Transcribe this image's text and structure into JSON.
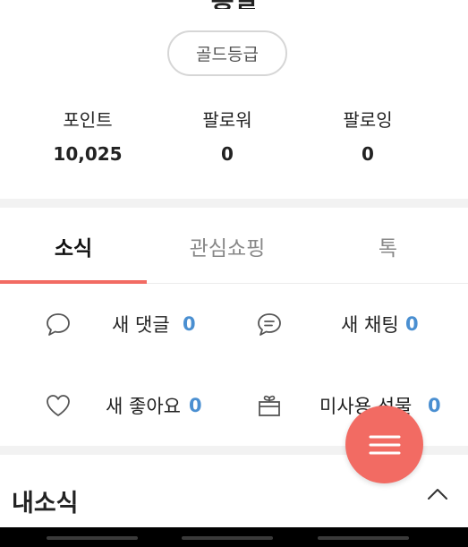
{
  "profile": {
    "name": "홍길",
    "grade": "골드등급"
  },
  "stats": [
    {
      "label": "포인트",
      "value": "10,025"
    },
    {
      "label": "팔로워",
      "value": "0"
    },
    {
      "label": "팔로잉",
      "value": "0"
    }
  ],
  "tabs": [
    {
      "label": "소식",
      "active": true
    },
    {
      "label": "관심쇼핑",
      "active": false
    },
    {
      "label": "톡",
      "active": false
    }
  ],
  "notifications": {
    "new_comments": {
      "label": "새 댓글",
      "count": "0",
      "icon": "comment-bubble-icon"
    },
    "new_chats": {
      "label": "새 채팅",
      "count": "0",
      "icon": "chat-bubble-icon"
    },
    "new_likes": {
      "label": "새 좋아요",
      "count": "0",
      "icon": "heart-icon"
    },
    "unused_gifts": {
      "label": "미사용 선물",
      "count": "0",
      "icon": "gift-icon"
    }
  },
  "my_news": {
    "title": "내소식"
  },
  "colors": {
    "accent": "#f26b63",
    "count_blue": "#4a8fd1",
    "divider": "#f2f2f2"
  }
}
